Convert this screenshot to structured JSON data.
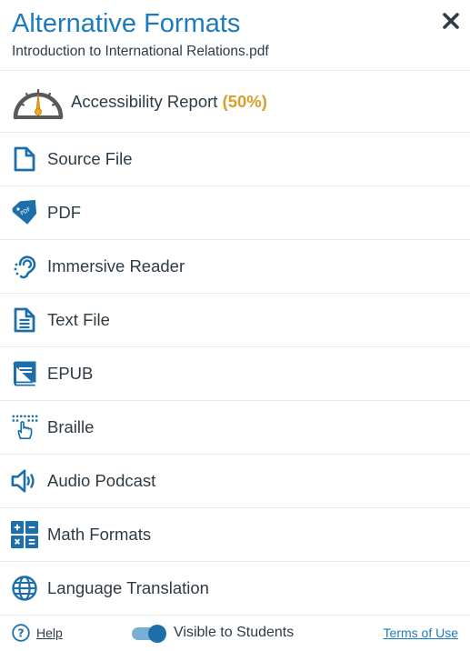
{
  "header": {
    "title": "Alternative Formats",
    "filename": "Introduction to International Relations.pdf"
  },
  "report": {
    "label": "Accessibility Report",
    "score": "(50%)",
    "score_value": 50,
    "score_color": "#d4a02a"
  },
  "formats": [
    {
      "label": "Source File",
      "icon": "file-icon"
    },
    {
      "label": "PDF",
      "icon": "pdf-tag-icon"
    },
    {
      "label": "Immersive Reader",
      "icon": "hearing-icon"
    },
    {
      "label": "Text File",
      "icon": "text-file-icon"
    },
    {
      "label": "EPUB",
      "icon": "book-icon"
    },
    {
      "label": "Braille",
      "icon": "braille-icon"
    },
    {
      "label": "Audio Podcast",
      "icon": "speaker-icon"
    },
    {
      "label": "Math Formats",
      "icon": "calculator-icon"
    },
    {
      "label": "Language Translation",
      "icon": "globe-icon"
    }
  ],
  "footer": {
    "help_label": "Help",
    "visibility_label": "Visible to Students",
    "visible": true,
    "terms_label": "Terms of Use"
  },
  "colors": {
    "accent": "#1d7bbd",
    "icon": "#1d6fa9",
    "text": "#2d3b45"
  },
  "pdf_tag_text": "PDF"
}
